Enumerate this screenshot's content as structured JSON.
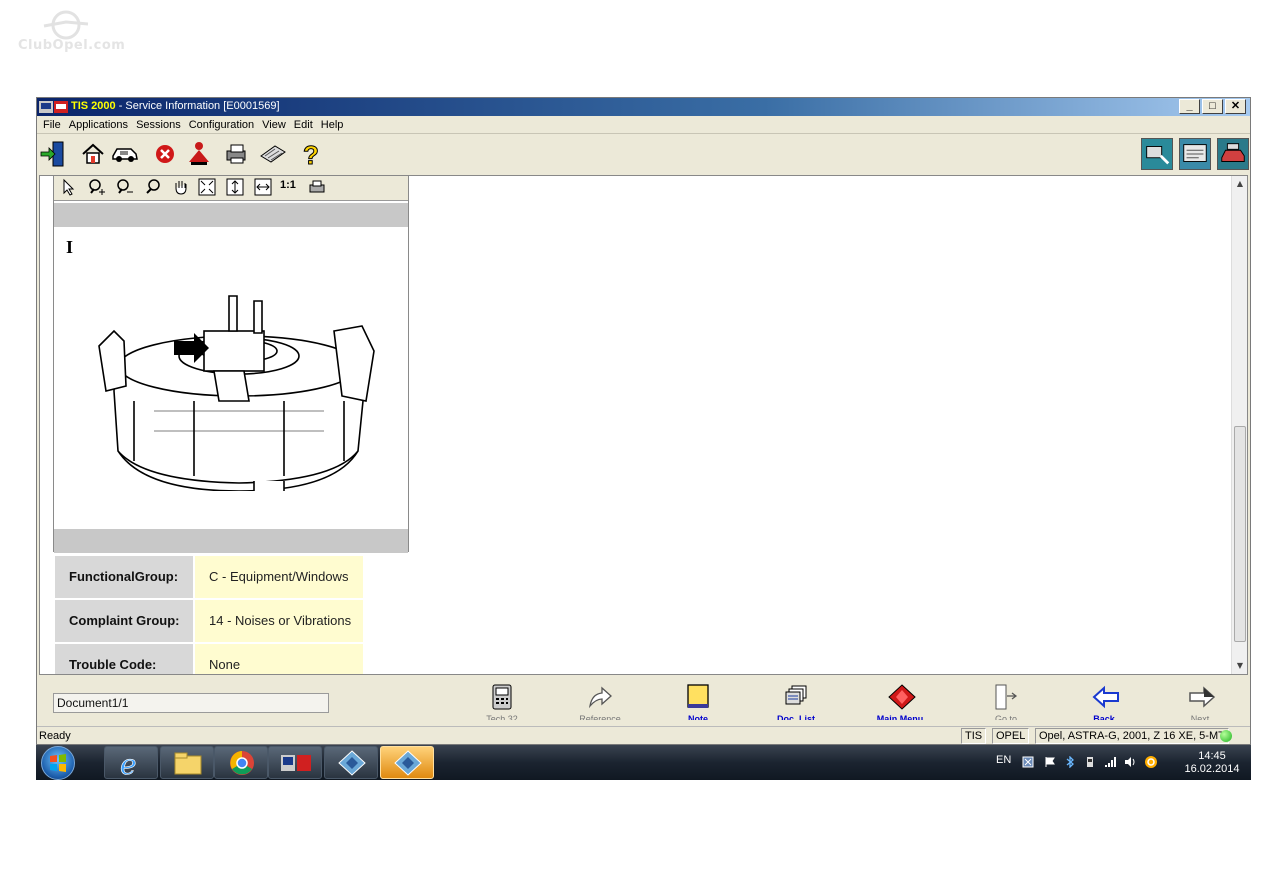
{
  "watermark": "ClubOpel.com",
  "window": {
    "title_app": "TIS 2000",
    "title_rest": " - Service Information [E0001569]",
    "min_label": "_",
    "max_label": "□",
    "close_label": "✕"
  },
  "menu": {
    "items": [
      {
        "label": "File"
      },
      {
        "label": "Applications"
      },
      {
        "label": "Sessions"
      },
      {
        "label": "Configuration"
      },
      {
        "label": "View"
      },
      {
        "label": "Edit"
      },
      {
        "label": "Help"
      }
    ]
  },
  "image_panel": {
    "zoom_label": "1:1",
    "figure_letter": "I"
  },
  "info": {
    "rows": [
      {
        "label": "FunctionalGroup:",
        "value": "C - Equipment/Windows"
      },
      {
        "label": "Complaint Group:",
        "value": "14 - Noises or Vibrations"
      },
      {
        "label": "Trouble Code:",
        "value": "None"
      }
    ]
  },
  "bottom": {
    "document_field": "Document1/1",
    "nav": [
      {
        "label": "Tech 32"
      },
      {
        "label": "Reference"
      },
      {
        "label": "Note"
      },
      {
        "label": "Doc. List"
      },
      {
        "label": "Main Menu"
      },
      {
        "label": "Go to"
      },
      {
        "label": "Back"
      },
      {
        "label": "Next"
      }
    ]
  },
  "status": {
    "ready": "Ready",
    "app": "TIS",
    "make": "OPEL",
    "vehicle": "Opel, ASTRA-G, 2001, Z 16 XE, 5-MT"
  },
  "taskbar": {
    "language": "EN",
    "time": "14:45",
    "date": "16.02.2014"
  }
}
